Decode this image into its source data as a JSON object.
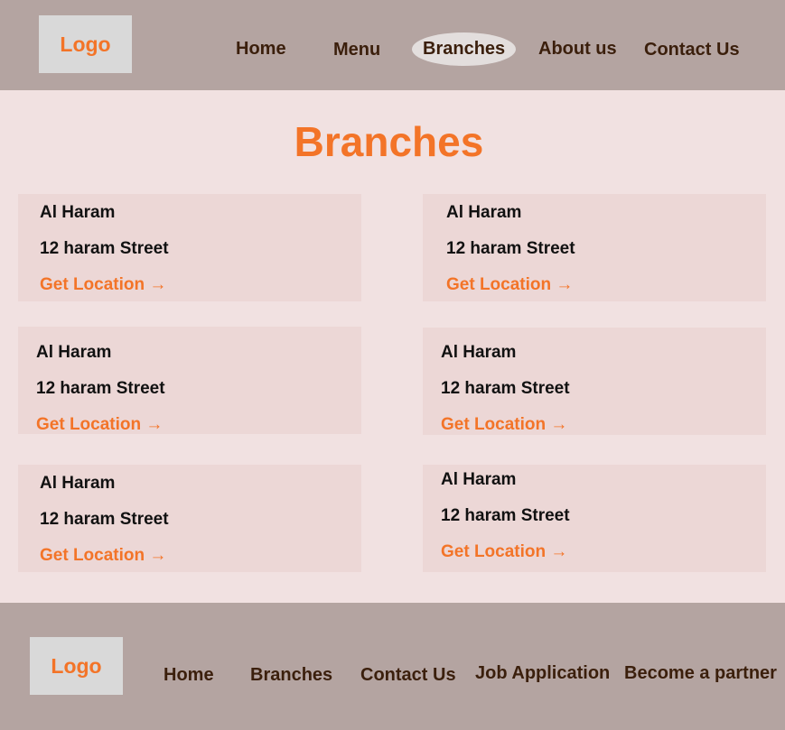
{
  "header": {
    "logo": "Logo",
    "nav": [
      "Home",
      "Menu",
      "Branches",
      "About us",
      "Contact Us"
    ],
    "active": "Branches"
  },
  "main": {
    "title": "Branches",
    "branches": [
      {
        "name": "Al Haram",
        "street": "12 haram Street",
        "link": "Get Location →"
      },
      {
        "name": "Al Haram",
        "street": "12 haram Street",
        "link": "Get Location →"
      },
      {
        "name": "Al Haram",
        "street": "12 haram Street",
        "link": "Get Location →"
      },
      {
        "name": "Al Haram",
        "street": "12 haram Street",
        "link": "Get Location →"
      },
      {
        "name": "Al Haram",
        "street": "12 haram Street",
        "link": "Get Location →"
      },
      {
        "name": "Al Haram",
        "street": "12 haram Street",
        "link": "Get Location →"
      }
    ]
  },
  "footer": {
    "logo": "Logo",
    "nav": [
      "Home",
      "Branches",
      "Contact Us",
      "Job Application",
      "Become a partner"
    ]
  },
  "colors": {
    "accent": "#f37428",
    "header_bg": "#b4a4a1",
    "page_bg": "#f1e1e1",
    "card_bg": "#ecd7d6",
    "nav_text": "#3b1f0c"
  }
}
